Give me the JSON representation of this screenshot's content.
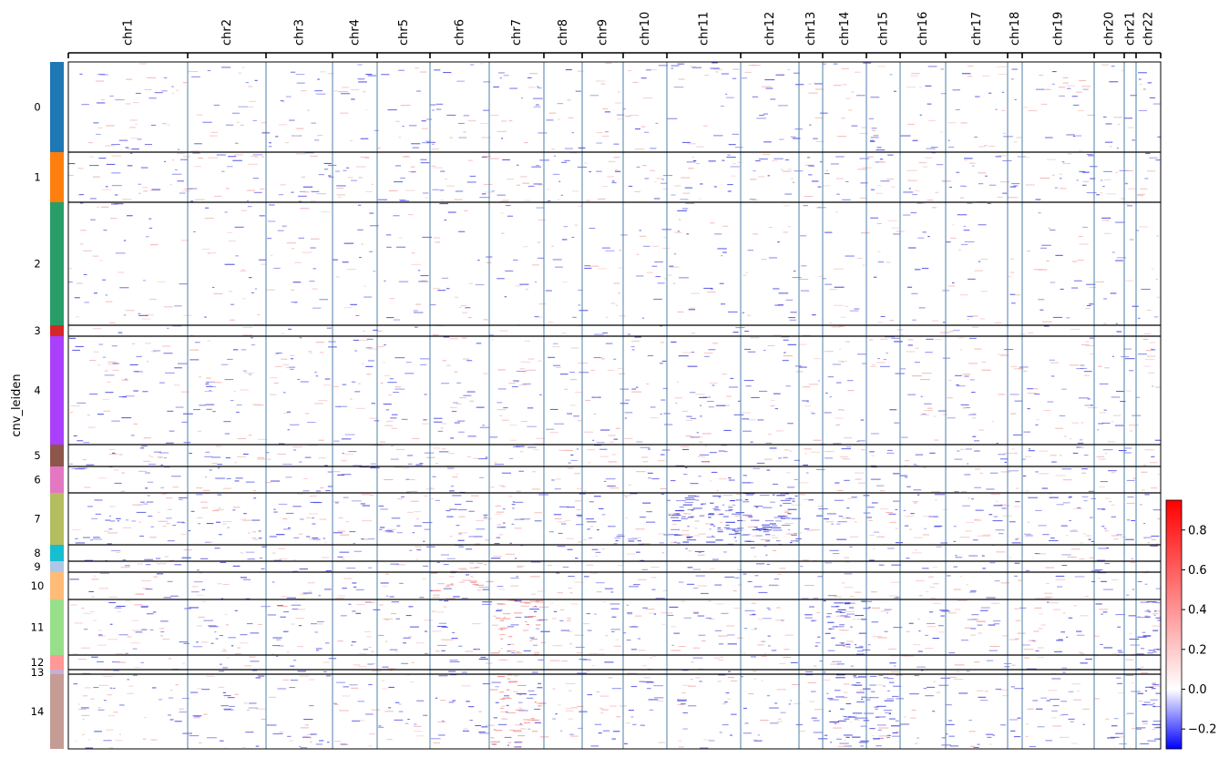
{
  "chart_data": {
    "type": "heatmap",
    "ylabel": "cnv_leiden",
    "x_groups": [
      "chr1",
      "chr2",
      "chr3",
      "chr4",
      "chr5",
      "chr6",
      "chr7",
      "chr8",
      "chr9",
      "chr10",
      "chr11",
      "chr12",
      "chr13",
      "chr14",
      "chr15",
      "chr16",
      "chr17",
      "chr18",
      "chr19",
      "chr20",
      "chr21",
      "chr22"
    ],
    "clusters": [
      {
        "label": "0",
        "color": "#1f77b4"
      },
      {
        "label": "1",
        "color": "#ff7f0e"
      },
      {
        "label": "2",
        "color": "#279e68"
      },
      {
        "label": "3",
        "color": "#d62728"
      },
      {
        "label": "4",
        "color": "#aa40fc"
      },
      {
        "label": "5",
        "color": "#8c564b"
      },
      {
        "label": "6",
        "color": "#e377c2"
      },
      {
        "label": "7",
        "color": "#b5bd61"
      },
      {
        "label": "8",
        "color": "#17becf"
      },
      {
        "label": "9",
        "color": "#aec7e8"
      },
      {
        "label": "10",
        "color": "#ffbb78"
      },
      {
        "label": "11",
        "color": "#98df8a"
      },
      {
        "label": "12",
        "color": "#ff9896"
      },
      {
        "label": "13",
        "color": "#c5b0d5"
      },
      {
        "label": "14",
        "color": "#c49c94"
      }
    ],
    "colorbar": {
      "cmap": "bwr",
      "vmin": -0.3,
      "vmax": 0.95,
      "ticks": [
        -0.2,
        0.0,
        0.2,
        0.4,
        0.6,
        0.8
      ],
      "tick_labels": [
        "−0.2",
        "0.0",
        "0.2",
        "0.4",
        "0.6",
        "0.8"
      ]
    },
    "gain_regions": [
      {
        "cluster": "9",
        "chr": "chr6"
      },
      {
        "cluster": "10",
        "chr": "chr6"
      },
      {
        "cluster": "11",
        "chr": "chr7"
      },
      {
        "cluster": "14",
        "chr": "chr7"
      }
    ],
    "loss_regions": [
      {
        "cluster": "7",
        "chr": "chr11"
      },
      {
        "cluster": "7",
        "chr": "chr12"
      },
      {
        "cluster": "11",
        "chr": "chr14"
      },
      {
        "cluster": "11",
        "chr": "chr22"
      },
      {
        "cluster": "14",
        "chr": "chr14"
      },
      {
        "cluster": "14",
        "chr": "chr15"
      },
      {
        "cluster": "14",
        "chr": "chr22"
      }
    ]
  }
}
